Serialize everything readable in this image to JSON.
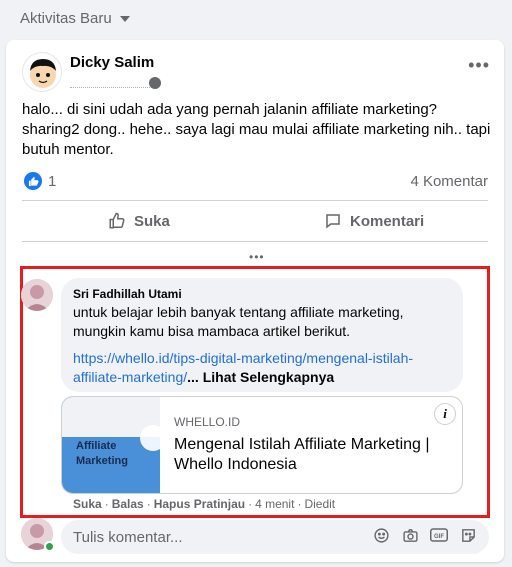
{
  "section": {
    "title": "Aktivitas Baru"
  },
  "post": {
    "author": "Dicky Salim",
    "text": "halo... di sini udah ada yang pernah jalanin affiliate marketing? sharing2 dong.. hehe.. saya lagi mau mulai affiliate marketing nih.. tapi butuh mentor.",
    "reactions_count": "1",
    "comments_count": "4 Komentar"
  },
  "actions": {
    "like": "Suka",
    "comment": "Komentari"
  },
  "comment": {
    "author": "Sri Fadhillah Utami",
    "text": "untuk belajar lebih banyak tentang affiliate marketing, mungkin kamu bisa mambaca artikel berikut.",
    "link": "https://whello.id/tips-digital-marketing/mengenal-istilah-affiliate-marketing/",
    "see_more": "... Lihat Selengkapnya",
    "preview": {
      "thumb_label_line1": "Affiliate",
      "thumb_label_line2": "Marketing",
      "domain": "WHELLO.ID",
      "title": "Mengenal Istilah Affiliate Marketing | Whello Indonesia"
    },
    "actions": {
      "like": "Suka",
      "reply": "Balas",
      "remove_preview": "Hapus Pratinjau",
      "time": "4 menit",
      "edited": "Diedit"
    }
  },
  "composer": {
    "placeholder": "Tulis komentar..."
  },
  "colors": {
    "accent": "#1877f2",
    "highlight": "#e41e1e",
    "online": "#31a24c"
  }
}
